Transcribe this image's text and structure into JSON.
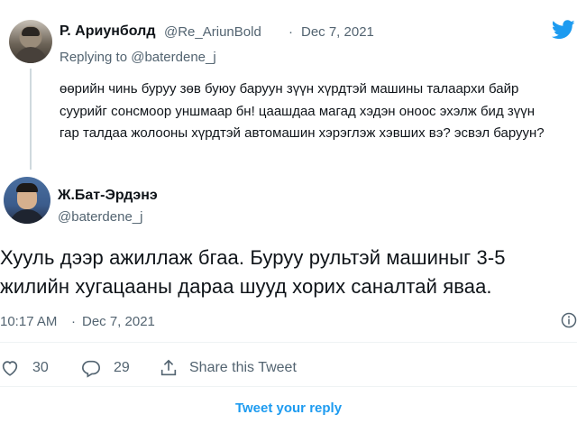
{
  "reply_tweet": {
    "author_name": "Р. Ариунболд",
    "author_handle": "@Re_AriunBold",
    "separator": "·",
    "date": "Dec 7, 2021",
    "replying_prefix": "Replying to ",
    "replying_to": "@baterdene_j",
    "text": "өөрийн чинь буруу зөв буюу баруун зүүн хүрдтэй машины талаархи байр суурийг сонсмоор уншмаар бн! цаашдаа магад хэдэн оноос эхэлж бид зүүн гар талдаа жолооны хүрдтэй автомашин хэрэглэж хэвших вэ? эсвэл баруун?"
  },
  "main_tweet": {
    "author_name": "Ж.Бат-Эрдэнэ",
    "author_handle": "@baterdene_j",
    "text": "Хууль дээр ажиллаж бгаа. Буруу рультэй машиныг 3-5 жилийн хугацааны дараа шууд хорих саналтай яваа.",
    "time": "10:17 AM",
    "separator": "·",
    "date": "Dec 7, 2021"
  },
  "actions": {
    "likes": "30",
    "replies": "29",
    "share_label": "Share this Tweet"
  },
  "cta": {
    "label": "Tweet your reply"
  },
  "colors": {
    "accent": "#1d9bf0",
    "muted": "#536471",
    "divider": "#eff3f4"
  },
  "icons": [
    "twitter-bird-icon",
    "heart-icon",
    "reply-bubble-icon",
    "share-icon",
    "info-icon"
  ]
}
